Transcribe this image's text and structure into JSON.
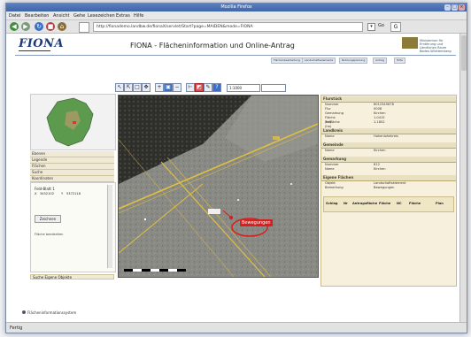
{
  "window": {
    "title": "Mozilla Firefox"
  },
  "menu": [
    "Datei",
    "Bearbeiten",
    "Ansicht",
    "Gehe",
    "Lesezeichen",
    "Extras",
    "Hilfe"
  ],
  "nav": {
    "url": "http://fionademo.landbw.de/fionaX/servlet/Start?page=MAIDEN&mode=FIONA",
    "go_label": "Go"
  },
  "header": {
    "logo": "FIONA",
    "title": "FIONA - Flächeninformation und Online-Antrag",
    "ministry": "Ministerium für Ernährung und Ländlichen Raum Baden-Württemberg",
    "tabs": [
      "Flächenbearbeitung",
      "Landschaftselemente",
      "Nutzungsplanung",
      "Antrag",
      "Hilfe"
    ]
  },
  "toolbar": {
    "scale": "1:1000"
  },
  "left_panel": {
    "items": [
      "Ebenen",
      "Legende",
      "Flächen",
      "Suche",
      "Koordinaten"
    ],
    "feature": "Feld-Blatt 1",
    "coords": {
      "x_label": "X",
      "x_value": "3452102",
      "y_label": "Y",
      "y_value": "5372118"
    },
    "button": "Zeichnen",
    "note": "Fläche bearbeiten",
    "bottom": "Suche Eigene Objekte"
  },
  "map": {
    "label": "Bewegungen"
  },
  "right_panel": {
    "sections": [
      {
        "title": "Flurstück",
        "rows": [
          [
            "Nummer",
            "6012345678"
          ],
          [
            "Flur",
            "0008"
          ],
          [
            "Gemarkung",
            "Kirchen"
          ],
          [
            "Fläche (ha)",
            "1.0415"
          ],
          [
            "Teilfläche (ha)",
            "1.1852"
          ]
        ]
      },
      {
        "title": "Landkreis",
        "rows": [
          [
            "Name",
            "Hohenlohekreis"
          ]
        ]
      },
      {
        "title": "Gemeinde",
        "rows": [
          [
            "Name",
            "Kirchen"
          ]
        ]
      },
      {
        "title": "Gemarkung",
        "rows": [
          [
            "Nummer",
            "612"
          ],
          [
            "Name",
            "Kirchen"
          ]
        ]
      },
      {
        "title": "Eigene Flächen",
        "rows": [
          [
            "Objekt",
            "Landschaftselement"
          ],
          [
            "Bemerkung",
            "Bewegungen"
          ]
        ]
      }
    ],
    "table": {
      "headers": [
        "Schlag",
        "Nr",
        "Antragsfläche",
        "Fläche",
        "NC",
        "Fläche",
        "Plan"
      ]
    }
  },
  "status_bar": {
    "text": "Flächeninformationssystem",
    "footer": "Fertig"
  }
}
